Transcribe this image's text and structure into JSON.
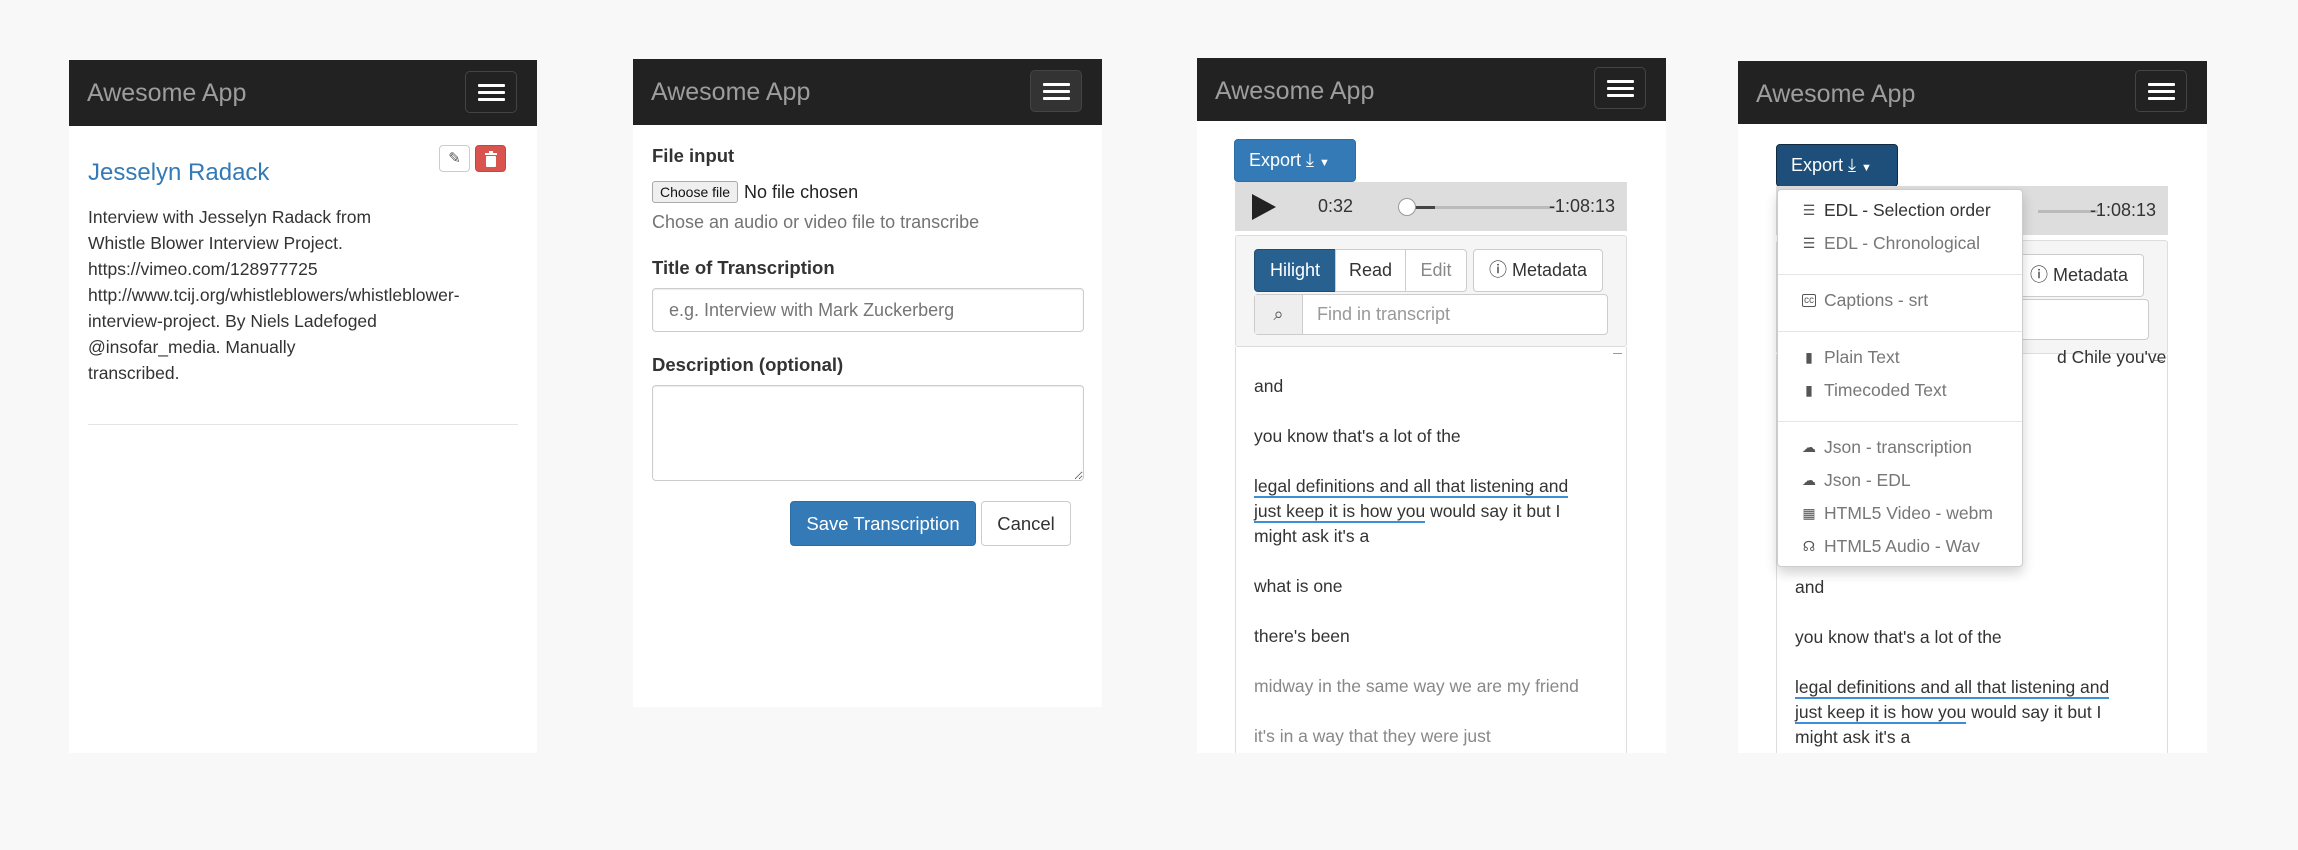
{
  "app": {
    "brand": "Awesome App"
  },
  "phone1": {
    "title": "Jesselyn Radack",
    "description": "Interview with Jesselyn Radack from\nWhistle Blower Interview Project.\nhttps://vimeo.com/128977725\nhttp://www.tcij.org/whistleblowers/whistleblower-\ninterview-project. By Niels Ladefoged\n@insofar_media. Manually\ntranscribed.",
    "edit_icon": "pencil-icon",
    "delete_icon": "trash-icon"
  },
  "phone2": {
    "file_label": "File input",
    "file_button": "Choose file",
    "file_status": "No file chosen",
    "file_help": "Chose an audio or video file to transcribe",
    "title_label": "Title of Transcription",
    "title_placeholder": "e.g. Interview with Mark Zuckerberg",
    "description_label": "Description (optional)",
    "save_label": "Save Transcription",
    "cancel_label": "Cancel"
  },
  "player": {
    "export_label": "Export",
    "current_time": "0:32",
    "remaining_time": "-1:08:13",
    "progress_fraction": 0.01
  },
  "tabs": {
    "hilight": "Hilight",
    "read": "Read",
    "edit": "Edit",
    "metadata": "Metadata",
    "search_placeholder": "Find in transcript"
  },
  "transcript": {
    "l1": "and",
    "l2": "you know that's a lot of the",
    "l3a": "legal definitions and all that listening and",
    "l3b": "just keep it is how you",
    "l3c": " would say it but I",
    "l3d": "might ask it's a",
    "l4": "what is one",
    "l5": "there's been",
    "l6": "midway in the same way we are my friend",
    "l7": "it's in a way that they were just",
    "partial": "d Chile you've"
  },
  "export_menu": {
    "edl_selection": "EDL - Selection order",
    "edl_chrono": "EDL - Chronological",
    "captions": "Captions - srt",
    "plain_text": "Plain Text",
    "timecoded_text": "Timecoded Text",
    "json_transcription": "Json - transcription",
    "json_edl": "Json - EDL",
    "html5_video": "HTML5 Video - webm",
    "html5_audio": "HTML5 Audio - Wav"
  }
}
